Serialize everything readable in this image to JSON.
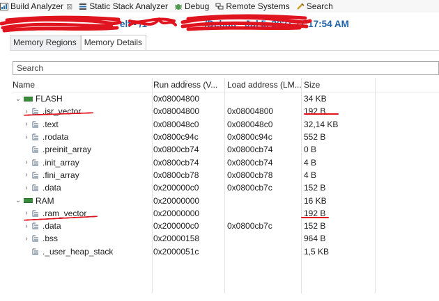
{
  "view_tabs": [
    {
      "label": "Build Analyzer",
      "icon": "build-analyzer-icon",
      "closable": true
    },
    {
      "label": "Static Stack Analyzer",
      "icon": "stack-analyzer-icon",
      "closable": false
    },
    {
      "label": "Debug",
      "icon": "debug-icon",
      "closable": false
    },
    {
      "label": "Remote Systems",
      "icon": "remote-systems-icon",
      "closable": false
    },
    {
      "label": "Search",
      "icon": "search-icon",
      "closable": false
    }
  ],
  "path_title": "elf - /1                      /Debug - Jul 5, 2021 11:17:54 AM",
  "sub_tabs": [
    "Memory Regions",
    "Memory Details"
  ],
  "active_sub_tab": "Memory Details",
  "search_placeholder": "Search",
  "columns": [
    "Name",
    "Run address (V...",
    "Load address (LM...",
    "Size"
  ],
  "rows": [
    {
      "name": "FLASH",
      "type": "region",
      "expanded": true,
      "run": "0x08004800",
      "load": "",
      "size": "34 KB",
      "indent": 0
    },
    {
      "name": ".isr_vector",
      "type": "section",
      "expandable": true,
      "run": "0x08004800",
      "load": "0x08004800",
      "size": "192 B",
      "indent": 1
    },
    {
      "name": ".text",
      "type": "section",
      "expandable": true,
      "run": "0x080048c0",
      "load": "0x080048c0",
      "size": "32,14 KB",
      "indent": 1
    },
    {
      "name": ".rodata",
      "type": "section",
      "expandable": true,
      "run": "0x0800c94c",
      "load": "0x0800c94c",
      "size": "552 B",
      "indent": 1
    },
    {
      "name": ".preinit_array",
      "type": "section",
      "expandable": false,
      "run": "0x0800cb74",
      "load": "0x0800cb74",
      "size": "0 B",
      "indent": 1
    },
    {
      "name": ".init_array",
      "type": "section",
      "expandable": true,
      "run": "0x0800cb74",
      "load": "0x0800cb74",
      "size": "4 B",
      "indent": 1
    },
    {
      "name": ".fini_array",
      "type": "section",
      "expandable": true,
      "run": "0x0800cb78",
      "load": "0x0800cb78",
      "size": "4 B",
      "indent": 1
    },
    {
      "name": ".data",
      "type": "section",
      "expandable": true,
      "run": "0x200000c0",
      "load": "0x0800cb7c",
      "size": "152 B",
      "indent": 1
    },
    {
      "name": "RAM",
      "type": "region",
      "expanded": true,
      "run": "0x20000000",
      "load": "",
      "size": "16 KB",
      "indent": 0
    },
    {
      "name": ".ram_vector",
      "type": "section",
      "expandable": true,
      "run": "0x20000000",
      "load": "",
      "size": "192 B",
      "indent": 1
    },
    {
      "name": ".data",
      "type": "section",
      "expandable": true,
      "run": "0x200000c0",
      "load": "0x0800cb7c",
      "size": "152 B",
      "indent": 1
    },
    {
      "name": ".bss",
      "type": "section",
      "expandable": true,
      "run": "0x20000158",
      "load": "",
      "size": "964 B",
      "indent": 1
    },
    {
      "name": "._user_heap_stack",
      "type": "section",
      "expandable": false,
      "run": "0x2000051c",
      "load": "",
      "size": "1,5 KB",
      "indent": 1
    }
  ],
  "colors": {
    "title_blue": "#2063a8",
    "annotation_red": "#e0141e",
    "region_chip": "#3c8b3c"
  }
}
